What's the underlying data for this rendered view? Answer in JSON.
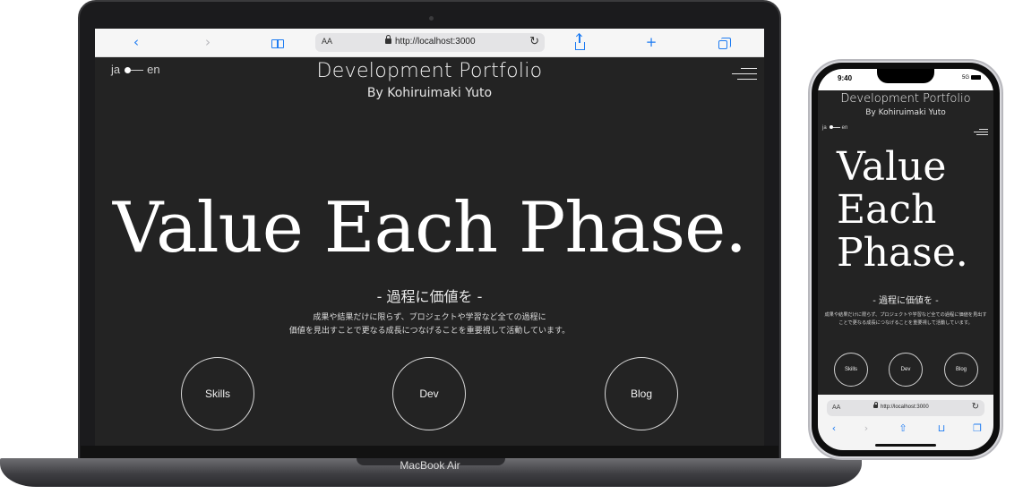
{
  "laptop": {
    "device_label": "MacBook Air",
    "browser": {
      "back_icon": "chevron-left-icon",
      "forward_icon": "chevron-right-icon",
      "text_size": "AA",
      "url": "http://localhost:3000",
      "new_tab": "+"
    }
  },
  "page": {
    "lang_ja": "ja",
    "lang_en": "en",
    "title": "Development Portfolio",
    "subtitle": "By Kohiruimaki Yuto",
    "hero": "Value Each Phase.",
    "hero_lines": [
      "Value",
      "Each",
      "Phase."
    ],
    "tagline": "- 過程に価値を -",
    "description_line1": "成果や結果だけに限らず、プロジェクトや学習など全ての過程に",
    "description_line2": "価値を見出すことで更なる成長につなげることを重要視して活動しています。",
    "description_full": "成果や結果だけに限らず、プロジェクトや学習など全ての過程に価値を見出すことで更なる成長につなげることを重要視して活動しています。",
    "nav": [
      "Skills",
      "Dev",
      "Blog"
    ]
  },
  "phone": {
    "time": "9:40",
    "signal": "5G",
    "text_size": "AA",
    "url": "http://localhost:3000"
  },
  "colors": {
    "page_bg": "#232323",
    "accent_blue": "#1e7cf2"
  }
}
